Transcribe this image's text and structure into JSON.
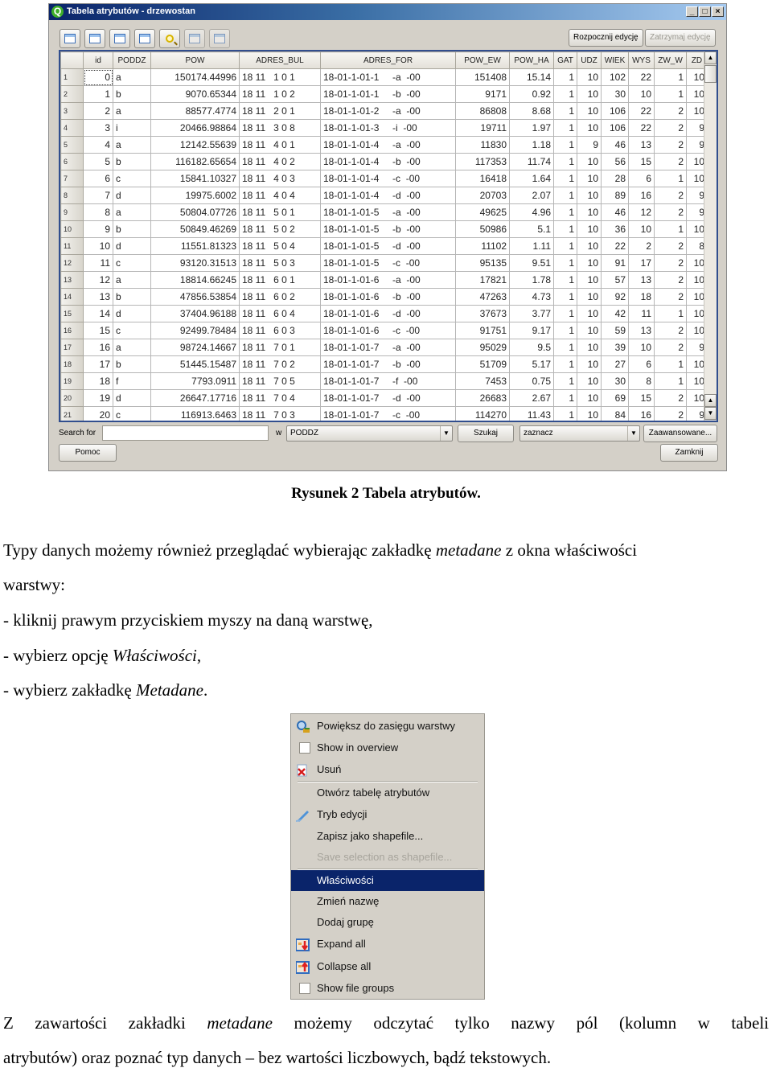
{
  "window": {
    "title": "Tabela atrybutów - drzewostan",
    "controls": [
      "_",
      "□",
      "×"
    ],
    "toolbar_icons": [
      "remove-selection-icon",
      "selected-to-top-icon",
      "invert-selection-icon",
      "copy-selected-icon",
      "zoom-to-selection-icon",
      "new-column-icon",
      "delete-column-icon"
    ],
    "start_edit_label": "Rozpocznij edycję",
    "stop_edit_label": "Zatrzymaj edycję"
  },
  "table": {
    "columns": [
      "id",
      "PODDZ",
      "POW",
      "ADRES_BUL",
      "ADRES_FOR",
      "POW_EW",
      "POW_HA",
      "GAT",
      "UDZ",
      "WIEK",
      "WYS",
      "ZW_W",
      "ZD"
    ],
    "rows": [
      [
        "0",
        "a",
        "150174.44996",
        "18 11   1 0 1",
        "18-01-1-01-1     -a  -00",
        "151408",
        "15.14",
        "1",
        "10",
        "102",
        "22",
        "1",
        "10"
      ],
      [
        "1",
        "b",
        "9070.65344",
        "18 11   1 0 2",
        "18-01-1-01-1     -b  -00",
        "9171",
        "0.92",
        "1",
        "10",
        "30",
        "10",
        "1",
        "10"
      ],
      [
        "2",
        "a",
        "88577.4774",
        "18 11   2 0 1",
        "18-01-1-01-2     -a  -00",
        "86808",
        "8.68",
        "1",
        "10",
        "106",
        "22",
        "2",
        "10"
      ],
      [
        "3",
        "i",
        "20466.98864",
        "18 11   3 0 8",
        "18-01-1-01-3     -i  -00",
        "19711",
        "1.97",
        "1",
        "10",
        "106",
        "22",
        "2",
        "9"
      ],
      [
        "4",
        "a",
        "12142.55639",
        "18 11   4 0 1",
        "18-01-1-01-4     -a  -00",
        "11830",
        "1.18",
        "1",
        "9",
        "46",
        "13",
        "2",
        "9"
      ],
      [
        "5",
        "b",
        "116182.65654",
        "18 11   4 0 2",
        "18-01-1-01-4     -b  -00",
        "117353",
        "11.74",
        "1",
        "10",
        "56",
        "15",
        "2",
        "10"
      ],
      [
        "6",
        "c",
        "15841.10327",
        "18 11   4 0 3",
        "18-01-1-01-4     -c  -00",
        "16418",
        "1.64",
        "1",
        "10",
        "28",
        "6",
        "1",
        "10"
      ],
      [
        "7",
        "d",
        "19975.6002",
        "18 11   4 0 4",
        "18-01-1-01-4     -d  -00",
        "20703",
        "2.07",
        "1",
        "10",
        "89",
        "16",
        "2",
        "9"
      ],
      [
        "8",
        "a",
        "50804.07726",
        "18 11   5 0 1",
        "18-01-1-01-5     -a  -00",
        "49625",
        "4.96",
        "1",
        "10",
        "46",
        "12",
        "2",
        "9"
      ],
      [
        "9",
        "b",
        "50849.46269",
        "18 11   5 0 2",
        "18-01-1-01-5     -b  -00",
        "50986",
        "5.1",
        "1",
        "10",
        "36",
        "10",
        "1",
        "10"
      ],
      [
        "10",
        "d",
        "11551.81323",
        "18 11   5 0 4",
        "18-01-1-01-5     -d  -00",
        "11102",
        "1.11",
        "1",
        "10",
        "22",
        "2",
        "2",
        "8"
      ],
      [
        "11",
        "c",
        "93120.31513",
        "18 11   5 0 3",
        "18-01-1-01-5     -c  -00",
        "95135",
        "9.51",
        "1",
        "10",
        "91",
        "17",
        "2",
        "10"
      ],
      [
        "12",
        "a",
        "18814.66245",
        "18 11   6 0 1",
        "18-01-1-01-6     -a  -00",
        "17821",
        "1.78",
        "1",
        "10",
        "57",
        "13",
        "2",
        "10"
      ],
      [
        "13",
        "b",
        "47856.53854",
        "18 11   6 0 2",
        "18-01-1-01-6     -b  -00",
        "47263",
        "4.73",
        "1",
        "10",
        "92",
        "18",
        "2",
        "10"
      ],
      [
        "14",
        "d",
        "37404.96188",
        "18 11   6 0 4",
        "18-01-1-01-6     -d  -00",
        "37673",
        "3.77",
        "1",
        "10",
        "42",
        "11",
        "1",
        "10"
      ],
      [
        "15",
        "c",
        "92499.78484",
        "18 11   6 0 3",
        "18-01-1-01-6     -c  -00",
        "91751",
        "9.17",
        "1",
        "10",
        "59",
        "13",
        "2",
        "10"
      ],
      [
        "16",
        "a",
        "98724.14667",
        "18 11   7 0 1",
        "18-01-1-01-7     -a  -00",
        "95029",
        "9.5",
        "1",
        "10",
        "39",
        "10",
        "2",
        "9"
      ],
      [
        "17",
        "b",
        "51445.15487",
        "18 11   7 0 2",
        "18-01-1-01-7     -b  -00",
        "51709",
        "5.17",
        "1",
        "10",
        "27",
        "6",
        "1",
        "10"
      ],
      [
        "18",
        "f",
        "7793.0911",
        "18 11   7 0 5",
        "18-01-1-01-7     -f  -00",
        "7453",
        "0.75",
        "1",
        "10",
        "30",
        "8",
        "1",
        "10"
      ],
      [
        "19",
        "d",
        "26647.17716",
        "18 11   7 0 4",
        "18-01-1-01-7     -d  -00",
        "26683",
        "2.67",
        "1",
        "10",
        "69",
        "15",
        "2",
        "10"
      ],
      [
        "20",
        "c",
        "116913.6463",
        "18 11   7 0 3",
        "18-01-1-01-7     -c  -00",
        "114270",
        "11.43",
        "1",
        "10",
        "84",
        "16",
        "2",
        "9"
      ]
    ],
    "numeric_columns": [
      0,
      2,
      5,
      6,
      7,
      8,
      9,
      10,
      11,
      12
    ]
  },
  "search": {
    "label": "Search for",
    "value": "",
    "in_label": "w",
    "field_selected": "PODDZ",
    "search_button": "Szukaj",
    "action_selected": "zaznacz",
    "advanced_button": "Zaawansowane..."
  },
  "footer": {
    "help_button": "Pomoc",
    "close_button": "Zamknij"
  },
  "document": {
    "caption": "Rysunek 2 Tabela atrybutów.",
    "p1_a": "Typy danych możemy również przeglądać wybierając zakładkę ",
    "p1_em": "metadane",
    "p1_b": " z okna właściwości",
    "p1_line2": "warstwy:",
    "step1": "- kliknij prawym przyciskiem myszy na daną warstwę,",
    "step2_a": "- wybierz opcję ",
    "step2_em": "Właściwości",
    "step2_b": ",",
    "step3_a": "- wybierz zakładkę ",
    "step3_em": "Metadane",
    "step3_b": ".",
    "p2_a": "Z zawartości zakładki ",
    "p2_em": "metadane",
    "p2_b": " możemy odczytać tylko nazwy pól (kolumn w tabeli",
    "p2_line2": "atrybutów) oraz poznać typ danych – bez wartości liczbowych, bądź tekstowych."
  },
  "context_menu": {
    "items": [
      {
        "label": "Powiększ do zasięgu warstwy",
        "icon": "zoom-to-layer-icon"
      },
      {
        "label": "Show in overview",
        "icon": "checkbox-icon"
      },
      {
        "label": "Usuń",
        "icon": "remove-layer-icon"
      },
      {
        "label": "Otwórz tabelę atrybutów",
        "icon": ""
      },
      {
        "label": "Tryb edycji",
        "icon": "pencil-icon"
      },
      {
        "label": "Zapisz jako shapefile...",
        "icon": ""
      },
      {
        "label": "Save selection as shapefile...",
        "icon": "",
        "disabled": true
      },
      {
        "label": "Właściwości",
        "icon": "",
        "active": true
      },
      {
        "label": "Zmień nazwę",
        "icon": ""
      },
      {
        "label": "Dodaj grupę",
        "icon": ""
      },
      {
        "label": "Expand all",
        "icon": "expand-all-icon"
      },
      {
        "label": "Collapse all",
        "icon": "collapse-all-icon"
      },
      {
        "label": "Show file groups",
        "icon": "checkbox-icon"
      }
    ]
  },
  "colors": {
    "title_bar": "#0a246a",
    "menu_highlight": "#0a246a",
    "grid_border": "#314e8e",
    "window_bg": "#d4d0c8"
  }
}
